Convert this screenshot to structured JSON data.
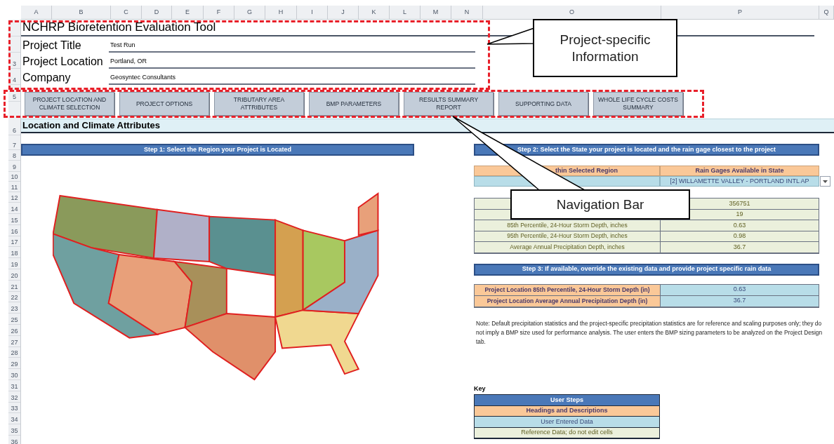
{
  "column_headers": [
    "A",
    "B",
    "C",
    "D",
    "E",
    "F",
    "G",
    "H",
    "I",
    "J",
    "K",
    "L",
    "M",
    "N",
    "O",
    "P",
    "Q"
  ],
  "row_numbers": [
    "3",
    "4",
    "5",
    "6",
    "7",
    "8",
    "9",
    "10",
    "11",
    "12",
    "14",
    "15",
    "16",
    "17",
    "18",
    "19",
    "20",
    "21",
    "22",
    "23",
    "25",
    "26",
    "27",
    "28",
    "29",
    "30",
    "31",
    "32",
    "33",
    "34",
    "35",
    "36"
  ],
  "title": "NCHRP Bioretention Evaluation Tool",
  "project_fields": [
    {
      "label": "Project Title",
      "value": "Test Run"
    },
    {
      "label": "Project Location",
      "value": "Portland, OR"
    },
    {
      "label": "Company",
      "value": "Geosyntec Consultants"
    }
  ],
  "nav_buttons": [
    "PROJECT LOCATION AND CLIMATE SELECTION",
    "PROJECT OPTIONS",
    "TRIBUTARY AREA ATTRIBUTES",
    "BMP PARAMETERS",
    "RESULTS SUMMARY REPORT",
    "SUPPORTING DATA",
    "WHOLE LIFE CYCLE COSTS SUMMARY"
  ],
  "section_title": "Location and Climate Attributes",
  "step1": {
    "title": "Step 1: Select the Region your Project is Located"
  },
  "step2": {
    "title": "Step 2: Select the State your project is located and the rain gage closest to the project",
    "columns": [
      "thin Selected Region",
      "Rain Gages Available in State"
    ],
    "selected_gage": "[2] WILLAMETTE VALLEY - PORTLAND INTL AP",
    "statistics": [
      {
        "value": "356751"
      },
      {
        "value": "19"
      },
      {
        "label": "85th Percentile, 24-Hour Storm Depth, inches",
        "value": "0.63"
      },
      {
        "label": "95th Percentile, 24-Hour Storm Depth, inches",
        "value": "0.98"
      },
      {
        "label": "Average Annual Precipitation Depth, inches",
        "value": "36.7"
      }
    ]
  },
  "step3": {
    "title": "Step 3: If available, override the existing data and provide project specific rain data",
    "rows": [
      {
        "label": "Project Location 85th Percentile, 24-Hour Storm Depth (in)",
        "value": "0.63"
      },
      {
        "label": "Project Location Average Annual Precipitation Depth (in)",
        "value": "36.7"
      }
    ]
  },
  "note": "Note: Default precipitation statistics and the project-specific precipitation statistics are for reference and scaling purposes only; they do not imply a BMP size used for performance analysis. The user enters the BMP sizing parameters to be analyzed on the Project Design tab.",
  "key": {
    "title": "Key",
    "items": [
      {
        "label": "User Steps",
        "kind": "step"
      },
      {
        "label": "Headings and Descriptions",
        "kind": "heading"
      },
      {
        "label": "User Entered Data",
        "kind": "input"
      },
      {
        "label": "Reference Data; do not edit cells",
        "kind": "reference"
      }
    ]
  },
  "callouts": [
    {
      "text": "Project-specific Information"
    },
    {
      "text": "Navigation Bar"
    }
  ]
}
